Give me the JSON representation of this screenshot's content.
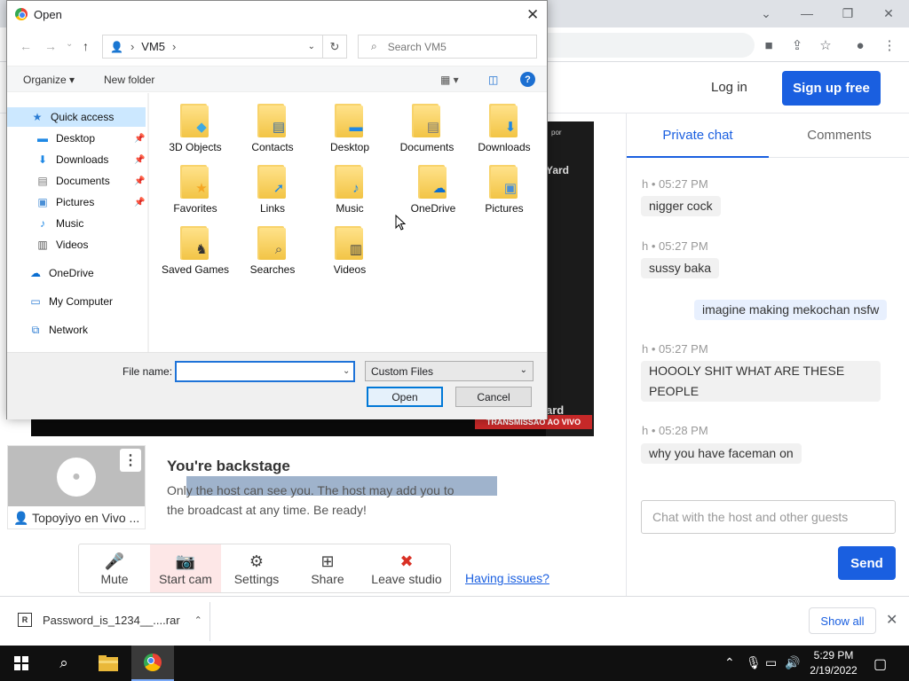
{
  "browser": {
    "window_controls": {
      "chevron": "⌄",
      "minimize": "—",
      "restore": "❐",
      "close": "✕"
    },
    "toolbar_icons": [
      "camera-icon",
      "share-icon",
      "star-icon",
      "profile-icon",
      "more-icon"
    ]
  },
  "site": {
    "login": "Log in",
    "signup": "Sign up free",
    "live_banner": "TRANSMISSAO AO VIVO",
    "video_overlay_top": "por",
    "video_overlay_text": "Yard",
    "video_overlay_bottom": "ard"
  },
  "stage": {
    "participant_name": "Topoyiyo en Vivo ...",
    "backstage_title": "You're backstage",
    "backstage_text": "Only the host can see you. The host may add you to the broadcast at any time. Be ready!",
    "controls": [
      {
        "label": "Mute",
        "icon": "🎤"
      },
      {
        "label": "Start cam",
        "icon": "📷"
      },
      {
        "label": "Settings",
        "icon": "⚙"
      },
      {
        "label": "Share",
        "icon": "⊞"
      },
      {
        "label": "Leave studio",
        "icon": "✖"
      }
    ],
    "having_issues": "Having issues?"
  },
  "chat": {
    "tabs": [
      {
        "label": "Private chat"
      },
      {
        "label": "Comments"
      }
    ],
    "messages": [
      {
        "sender": "h",
        "time": "05:27 PM",
        "text": "nigger cock"
      },
      {
        "sender": "h",
        "time": "05:27 PM",
        "text": "sussy baka"
      },
      {
        "sender": "",
        "time": "",
        "text": "imagine making mekochan nsfw"
      },
      {
        "sender": "h",
        "time": "05:27 PM",
        "text": "HOOOLY SHIT WHAT ARE THESE PEOPLE"
      },
      {
        "sender": "h",
        "time": "05:28 PM",
        "text": "why you have faceman on"
      }
    ],
    "input_placeholder": "Chat with the host and other guests",
    "send": "Send"
  },
  "download_shelf": {
    "file_name": "Password_is_1234__....rar",
    "file_icon": "R",
    "show_all": "Show all"
  },
  "taskbar": {
    "time": "5:29 PM",
    "date": "2/19/2022"
  },
  "dialog": {
    "title": "Open",
    "breadcrumb": [
      "VM5"
    ],
    "search_placeholder": "Search VM5",
    "organize": "Organize ▾",
    "new_folder": "New folder",
    "help": "?",
    "nav": {
      "quick_access": "Quick access",
      "items": [
        "Desktop",
        "Downloads",
        "Documents",
        "Pictures",
        "Music",
        "Videos"
      ],
      "onedrive": "OneDrive",
      "my_computer": "My Computer",
      "network": "Network"
    },
    "folders": [
      {
        "name": "3D Objects",
        "icon": "cube-icon"
      },
      {
        "name": "Contacts",
        "icon": "contacts-icon"
      },
      {
        "name": "Desktop",
        "icon": "desktop-icon"
      },
      {
        "name": "Documents",
        "icon": "documents-icon"
      },
      {
        "name": "Downloads",
        "icon": "downloads-icon"
      },
      {
        "name": "Favorites",
        "icon": "star-icon"
      },
      {
        "name": "Links",
        "icon": "link-arrow-icon"
      },
      {
        "name": "Music",
        "icon": "music-note-icon"
      },
      {
        "name": "OneDrive",
        "icon": "cloud-icon"
      },
      {
        "name": "Pictures",
        "icon": "picture-icon"
      },
      {
        "name": "Saved Games",
        "icon": "chess-icon"
      },
      {
        "name": "Searches",
        "icon": "magnifier-icon"
      },
      {
        "name": "Videos",
        "icon": "film-icon"
      }
    ],
    "file_name_label": "File name:",
    "file_name_value": "",
    "filter": "Custom Files",
    "open": "Open",
    "cancel": "Cancel"
  }
}
